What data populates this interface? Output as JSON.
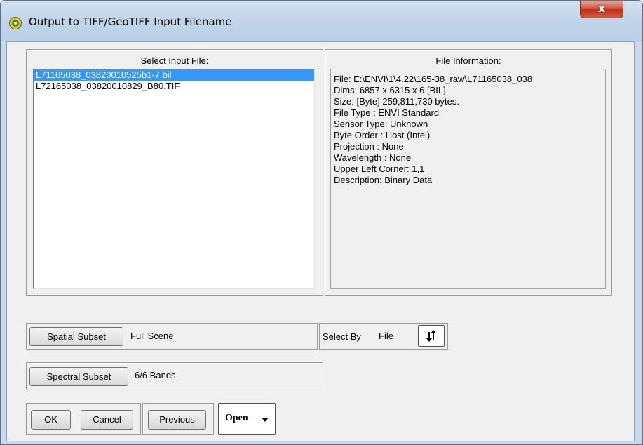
{
  "window": {
    "title": "Output to TIFF/GeoTIFF Input Filename",
    "close_label": "x"
  },
  "input_files": {
    "header": "Select Input File:",
    "items": [
      {
        "label": "L71165038_03820010525b1-7.bil",
        "selected": true
      },
      {
        "label": "L72165038_03820010829_B80.TIF",
        "selected": false
      }
    ]
  },
  "file_info": {
    "header": "File Information:",
    "lines": [
      "File: E:\\ENVI\\1\\4.22\\165-38_raw\\L71165038_038",
      "Dims: 6857 x 6315 x 6 [BIL]",
      "Size: [Byte] 259,811,730 bytes.",
      "File Type  : ENVI Standard",
      "Sensor Type: Unknown",
      "Byte Order : Host (Intel)",
      "Projection : None",
      "Wavelength : None",
      "Upper Left Corner: 1,1",
      "Description: Binary Data"
    ]
  },
  "spatial_subset": {
    "button_label": "Spatial Subset",
    "value": "Full Scene"
  },
  "select_by": {
    "label": "Select By",
    "value": "File",
    "toggle_icon": "sort-toggle-icon"
  },
  "spectral_subset": {
    "button_label": "Spectral Subset",
    "value": "6/6 Bands"
  },
  "actions": {
    "ok_label": "OK",
    "cancel_label": "Cancel",
    "previous_label": "Previous",
    "open_label": "Open"
  },
  "colors": {
    "selection": "#3399ff",
    "close_button": "#c7432b",
    "title_bar": "#c2d5ea"
  }
}
